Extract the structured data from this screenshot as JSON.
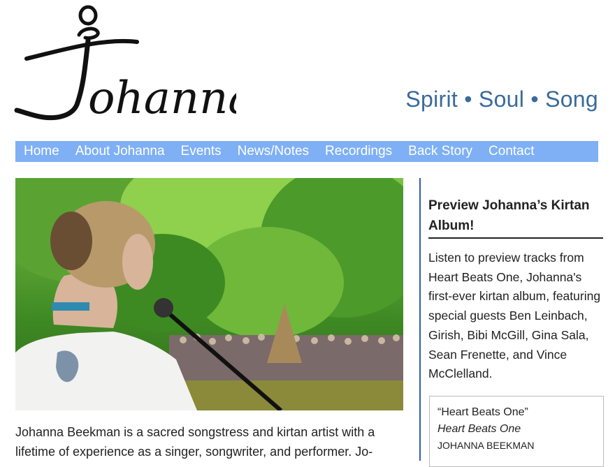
{
  "header": {
    "logo_text": "Johanna",
    "tagline": "Spirit • Soul • Song"
  },
  "nav": {
    "items": [
      "Home",
      "About Johanna",
      "Events",
      "News/Notes",
      "Recordings",
      "Back Story",
      "Contact"
    ]
  },
  "main": {
    "intro_line1": "Johanna Beekman is a sacred songstress and kirtan artist with a",
    "intro_line2": "lifetime of experience as a singer, songwriter, and performer. Jo-"
  },
  "sidebar": {
    "title": "Preview Johanna’s Kirtan Album!",
    "description": "Listen to preview tracks from Heart Beats One, Johanna's first-ever kirtan album, featuring special guests Ben Leinbach, Girish, Bibi McGill, Gina Sala, Sean Frenette, and Vince McClelland.",
    "player": {
      "track": "“Heart Beats One”",
      "album": "Heart Beats One",
      "artist": "JOHANNA BEEKMAN"
    }
  }
}
